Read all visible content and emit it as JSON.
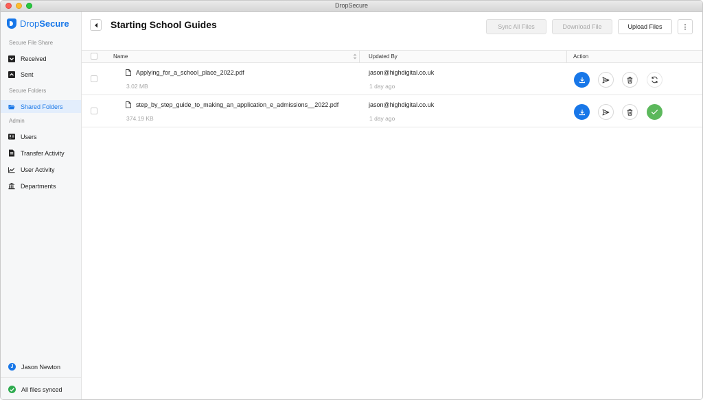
{
  "window": {
    "title": "DropSecure"
  },
  "brand": {
    "name_light": "Drop",
    "name_bold": "Secure"
  },
  "sidebar": {
    "section_file_share": "Secure File Share",
    "received": "Received",
    "sent": "Sent",
    "section_folders": "Secure Folders",
    "shared_folders": "Shared Folders",
    "section_admin": "Admin",
    "users": "Users",
    "transfer_activity": "Transfer Activity",
    "user_activity": "User Activity",
    "departments": "Departments",
    "user_name": "Jason Newton",
    "user_initial": "J",
    "sync_status": "All files synced"
  },
  "header": {
    "title": "Starting School Guides",
    "sync_all": "Sync All Files",
    "download_file": "Download File",
    "upload_files": "Upload Files",
    "more": "⋮"
  },
  "table": {
    "col_name": "Name",
    "col_updated": "Updated By",
    "col_action": "Action",
    "rows": [
      {
        "name": "Applying_for_a_school_place_2022.pdf",
        "size": "3.02 MB",
        "updated_by": "jason@highdigital.co.uk",
        "updated_time": "1 day ago",
        "sync_state": "sync"
      },
      {
        "name": "step_by_step_guide_to_making_an_application_e_admissions__2022.pdf",
        "size": "374.19 KB",
        "updated_by": "jason@highdigital.co.uk",
        "updated_time": "1 day ago",
        "sync_state": "synced"
      }
    ]
  },
  "colors": {
    "accent": "#1877e8",
    "success": "#5cb85c",
    "sync_green": "#2eab4f"
  }
}
